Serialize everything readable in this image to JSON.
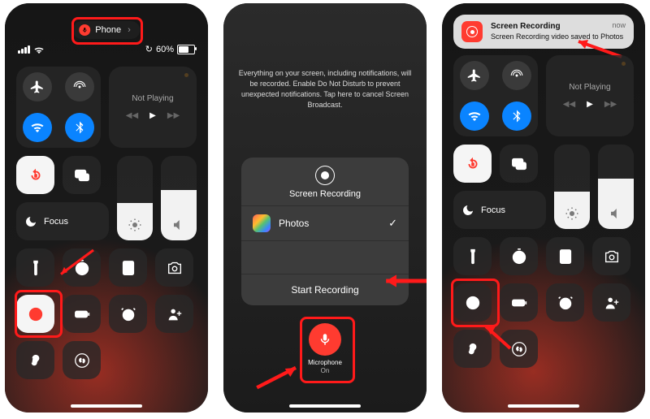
{
  "panel1": {
    "pill_label": "Phone",
    "battery_pct": "60%",
    "battery_fill": 60,
    "not_playing": "Not Playing",
    "focus_label": "Focus"
  },
  "panel2": {
    "info_text": "Everything on your screen, including notifications, will be recorded. Enable Do Not Disturb to prevent unexpected notifications. Tap here to cancel Screen Broadcast.",
    "sheet_title": "Screen Recording",
    "app_name": "Photos",
    "start_label": "Start Recording",
    "mic_label": "Microphone",
    "mic_state": "On"
  },
  "panel3": {
    "banner_title": "Screen Recording",
    "banner_body": "Screen Recording video saved to Photos",
    "banner_when": "now",
    "not_playing": "Not Playing",
    "focus_label": "Focus"
  },
  "icons": {
    "airplane": "airplane",
    "airdrop": "airdrop",
    "wifi": "wifi",
    "bluetooth": "bluetooth",
    "lock_rotation": "lock-rotation",
    "mirror": "screen-mirror",
    "moon": "moon",
    "brightness": "brightness",
    "volume": "volume",
    "flashlight": "flashlight",
    "timer": "timer",
    "calculator": "calculator",
    "camera": "camera",
    "record": "record",
    "low_power": "low-power",
    "alarm": "alarm",
    "person": "add-contact",
    "hearing": "hearing",
    "shazam": "shazam"
  }
}
